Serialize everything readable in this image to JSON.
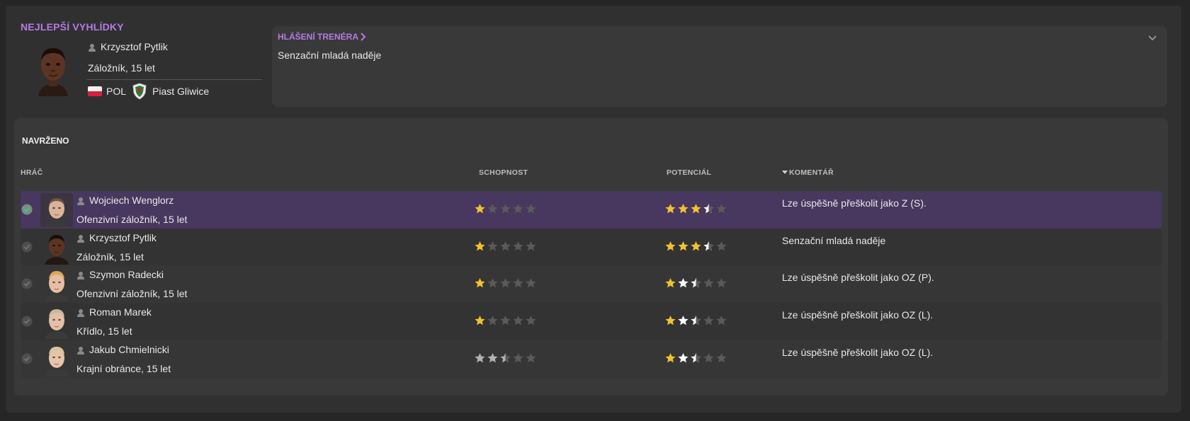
{
  "top": {
    "title": "NEJLEPŠÍ VYHLÍDKY",
    "player_name": "Krzysztof Pytlik",
    "position_age": "Záložník, 15 let",
    "nationality": "POL",
    "club": "Piast Gliwice"
  },
  "report": {
    "title": "HLÁŠENÍ TRENÉRA",
    "text": "Senzační mladá naděje"
  },
  "suggested": {
    "title": "NAVRŽENO",
    "columns": {
      "player": "HRÁČ",
      "ability": "SCHOPNOST",
      "potential": "POTENCIÁL",
      "comment": "KOMENTÁŘ"
    },
    "rows": [
      {
        "name": "Wojciech Wenglorz",
        "position_age": "Ofenzivní záložník, 15 let",
        "ability_stars": 1,
        "potential_stars": 3.5,
        "ability_color": "gold",
        "comment": "Lze úspěšně přeškolit jako Z (S).",
        "selected": true
      },
      {
        "name": "Krzysztof Pytlik",
        "position_age": "Záložník, 15 let",
        "ability_stars": 1,
        "potential_stars": 3.5,
        "ability_color": "gold",
        "comment": "Senzační mladá naděje",
        "selected": false
      },
      {
        "name": "Szymon Radecki",
        "position_age": "Ofenzivní záložník, 15 let",
        "ability_stars": 1,
        "potential_stars": 2.5,
        "ability_color": "gold",
        "comment": "Lze úspěšně přeškolit jako OZ (P).",
        "selected": false
      },
      {
        "name": "Roman Marek",
        "position_age": "Křídlo, 15 let",
        "ability_stars": 1,
        "potential_stars": 2.5,
        "ability_color": "gold",
        "comment": "Lze úspěšně přeškolit jako OZ (L).",
        "selected": false
      },
      {
        "name": "Jakub Chmielnicki",
        "position_age": "Krajní obránce, 15 let",
        "ability_stars": 2.5,
        "potential_stars": 2.5,
        "ability_color": "silver",
        "comment": "Lze úspěšně přeškolit jako OZ (L).",
        "selected": false
      }
    ]
  },
  "colors": {
    "accent": "#b57be6",
    "selected_row": "#48375f",
    "star_gold": "#f2c12e",
    "star_white": "#ffffff",
    "star_silver": "#b3b3b3",
    "star_empty": "#5a5a5a"
  }
}
